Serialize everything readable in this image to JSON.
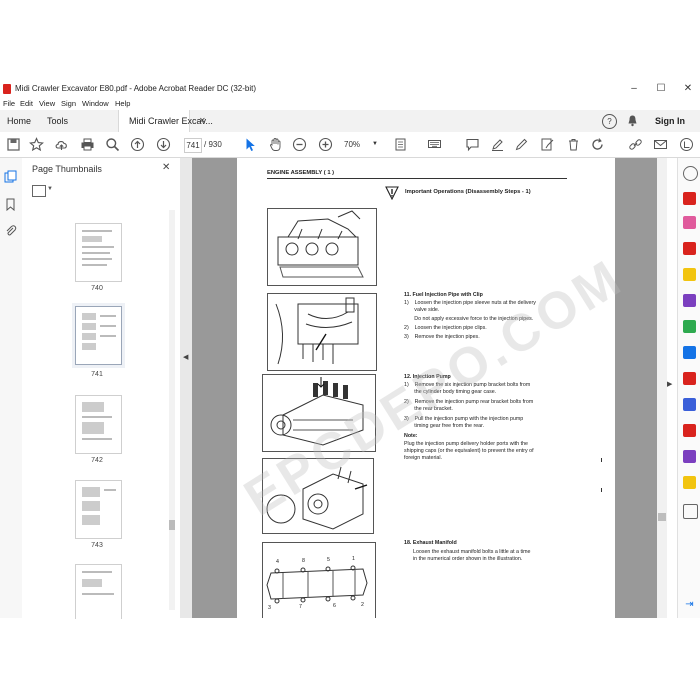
{
  "window": {
    "title": "Midi Crawler Excavator E80.pdf - Adobe Acrobat Reader DC (32-bit)",
    "controls": [
      "–",
      "☐",
      "✕"
    ]
  },
  "menu": [
    "File",
    "Edit",
    "View",
    "Sign",
    "Window",
    "Help"
  ],
  "tabs": {
    "home": "Home",
    "tools": "Tools",
    "document": "Midi Crawler Excav...",
    "document_close": "✕",
    "signin": "Sign In"
  },
  "toolbar": {
    "page_current": "741",
    "page_total": "/ 930",
    "zoom": "70%"
  },
  "thumbnails": {
    "header": "Page Thumbnails",
    "close": "✕",
    "pages": [
      "740",
      "741",
      "742",
      "743"
    ]
  },
  "document": {
    "section_header": "ENGINE ASSEMBLY ( 1 )",
    "important_title": "Important Operations (Disassembly Steps - 1)",
    "step11_title": "11.  Fuel Injection Pipe with Clip",
    "step11_lines": [
      "1)    Loosen the injection pipe sleeve nuts at the delivery",
      "       valve side.",
      "       Do not apply excessive force to the injection pipes.",
      "2)    Loosen the injection pipe clips.",
      "3)    Remove the injection pipes."
    ],
    "step12_title": "12.  Injection Pump",
    "step12_lines": [
      "1)    Remove the six injection pump bracket bolts from",
      "       the cylinder body timing gear case.",
      "2)    Remove the injection pump rear bracket bolts from",
      "       the rear bracket.",
      "3)    Pull the injection pump with the injection pump",
      "       timing gear free from the rear."
    ],
    "note_title": "Note:",
    "note_lines": [
      "Plug the injection pump delivery holder ports with the",
      "shipping caps (or the equivalent) to prevent the entry of",
      "foreign material."
    ],
    "step18_title": "18.  Exhaust Manifold",
    "step18_lines": [
      "Loosen the exhaust manifold bolts a little at a time",
      "in the numerical order shown in the illustration."
    ],
    "manifold_numbers_top": [
      "4",
      "8",
      "5",
      "1"
    ],
    "manifold_numbers_bottom": [
      "3",
      "7",
      "6",
      "2"
    ],
    "watermark": "EPCDEPO.COM"
  },
  "colors": {
    "accent_blue": "#1473e6",
    "acrobat_red": "#d9231d",
    "doc_background": "#999999"
  }
}
